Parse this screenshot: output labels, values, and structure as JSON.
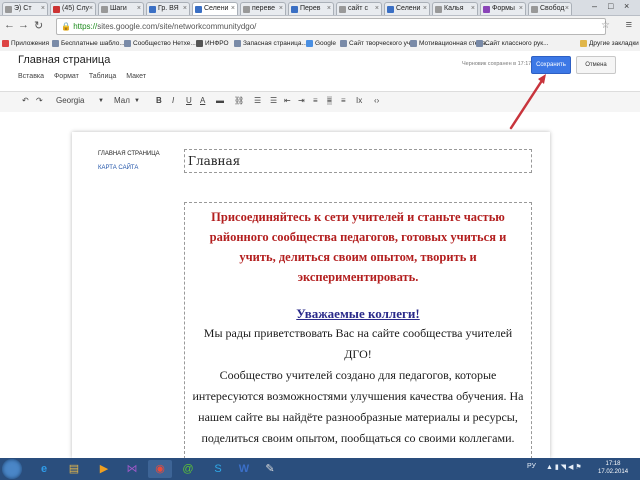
{
  "browser": {
    "tabs": [
      {
        "label": "Э) Ст"
      },
      {
        "label": "(45) Слу"
      },
      {
        "label": "Шаги"
      },
      {
        "label": "Гр. ВЯ"
      },
      {
        "label": "Селени"
      },
      {
        "label": "переве"
      },
      {
        "label": "Перев"
      },
      {
        "label": "сайт с"
      },
      {
        "label": "Селени"
      },
      {
        "label": "Калья"
      },
      {
        "label": "Формы"
      },
      {
        "label": "Свобод"
      }
    ],
    "url_https": "https://",
    "url_rest": "sites.google.com/site/networkcommunitydgo/",
    "bookmarks": [
      {
        "label": "Приложения"
      },
      {
        "label": "Бесплатные шабло..."
      },
      {
        "label": "Сообщество Нетхе..."
      },
      {
        "label": "ИНФРО"
      },
      {
        "label": "Запасная страница..."
      },
      {
        "label": "Google"
      },
      {
        "label": "Сайт творческого уч..."
      },
      {
        "label": "Мотивационная стена..."
      },
      {
        "label": "Сайт классного рук..."
      },
      {
        "label": "Другие закладки"
      }
    ]
  },
  "editor": {
    "page_title": "Главная страница",
    "menus": [
      "Вставка",
      "Формат",
      "Таблица",
      "Макет"
    ],
    "autosave": "Черновик сохранен в 17:17",
    "save_label": "Сохранить",
    "cancel_label": "Отмена",
    "toolbar": {
      "font": "Georgia",
      "size": "Мал"
    }
  },
  "sidebar": {
    "home": "ГЛАВНАЯ СТРАНИЦА",
    "sitemap": "КАРТА САЙТА"
  },
  "page": {
    "heading": "Главная",
    "intro_lines": [
      "Присоединяйтесь к сети учителей и станьте частью",
      "районного сообщества педагогов, готовых учиться и",
      "учить, делиться своим опытом, творить и",
      "экспериментировать."
    ],
    "greeting": "Уважаемые коллеги!",
    "body_lines": [
      "Мы рады приветствовать Вас на сайте сообщества учителей ДГО!",
      "Сообщество учителей создано для педагогов, которые",
      "интересуются возможностями улучшения качества обучения. На",
      "нашем сайте вы найдёте разнообразные материалы и ресурсы,",
      "поделиться своим опытом, пообщаться со своими коллегами."
    ]
  },
  "taskbar": {
    "lang": "РУ",
    "time": "17:18",
    "date": "17.02.2014"
  },
  "colors": {
    "save_button": "#3c78e6",
    "intro_text": "#b31f1f",
    "greeting_text": "#2a2a8a",
    "annotation_arrow": "#c8343c",
    "taskbar": "#2a4e7d"
  }
}
